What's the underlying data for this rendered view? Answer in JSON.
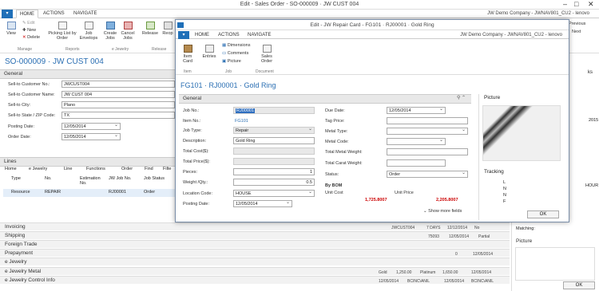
{
  "window": {
    "title": "Edit - Sales Order - SO-000009 · JW CUST 004",
    "minimize": "–",
    "maximize": "□",
    "close": "✕"
  },
  "tabs": [
    "HOME",
    "ACTIONS",
    "NAVIGATE"
  ],
  "company": "JW Demo Company - JWNAV801_CU2 - lenovo",
  "ribbon": {
    "view": "View",
    "edit": "Edit",
    "new": "New",
    "delete": "Delete",
    "picking_list": "Picking List by Order",
    "job_envelops": "Job Envelops",
    "create_jobs": "Create Jobs",
    "cancel_jobs": "Cancel Jobs",
    "release": "Release",
    "reopen": "Reop",
    "previous": "Previous",
    "next": "Next",
    "groups": {
      "manage": "Manage",
      "reports": "Reports",
      "ejewelry": "e Jewelry",
      "release": "Release"
    }
  },
  "page_title": "SO-000009 · JW CUST 004",
  "general": {
    "header": "General",
    "fields": [
      {
        "label": "Sell-to Customer No.:",
        "value": "JWCUST004"
      },
      {
        "label": "Sell-to Customer Name:",
        "value": "JW CUST 004"
      },
      {
        "label": "Sell-to City:",
        "value": "Plano"
      },
      {
        "label": "Sell-to State / ZIP Code:",
        "value": "TX"
      },
      {
        "label": "Posting Date:",
        "value": "12/05/2014"
      },
      {
        "label": "Order Date:",
        "value": "12/05/2014"
      }
    ]
  },
  "lines": {
    "header": "Lines",
    "toolbar": [
      "Home",
      "e Jewelry",
      "Line",
      "Functions",
      "Order",
      "Find",
      "Filte"
    ],
    "columns": [
      "Type",
      "No.",
      "Estimation No.",
      "JW Job No.",
      "Job Status"
    ],
    "row": [
      "Resource",
      "REPAIR",
      "",
      "RJ00001",
      "Order"
    ]
  },
  "fasttabs": [
    {
      "label": "Invoicing",
      "vals": [
        "JWCUST004",
        "7 DAYS",
        "12/12/2014",
        "No"
      ]
    },
    {
      "label": "Shipping",
      "vals": [
        "75093",
        "12/05/2014",
        "Partial"
      ]
    },
    {
      "label": "Foreign Trade",
      "vals": []
    },
    {
      "label": "Prepayment",
      "vals": [
        "0",
        "12/05/2014"
      ]
    },
    {
      "label": "e Jewelry",
      "vals": []
    },
    {
      "label": "e Jewelry Metal",
      "vals": [
        "Gold",
        "1,250.00",
        "Platinum",
        "1,650.00",
        "12/05/2014"
      ]
    },
    {
      "label": "e Jewelry Control Info",
      "vals": [
        "12/05/2014",
        "BCINC\\ANIL",
        "12/05/2014",
        "BCINC\\ANIL"
      ]
    }
  ],
  "right_panel": {
    "hours": "HOUR",
    "year": "2015",
    "matching": "Matching:",
    "picture": "Picture",
    "ok": "OK",
    "ks": "ks"
  },
  "dialog": {
    "title": "Edit - JW Repair Card - FG101 · RJ00001 · Gold Ring",
    "tabs": [
      "HOME",
      "ACTIONS",
      "NAVIGATE"
    ],
    "company": "JW Demo Company - JWNAV801_CU2 - lenovo",
    "ribbon": {
      "item_card": "Item Card",
      "entries": "Entries",
      "dimensions": "Dimensions",
      "comments": "Comments",
      "picture": "Picture",
      "sales_order": "Sales Order",
      "g_item": "Item",
      "g_job": "Job",
      "g_document": "Document"
    },
    "page_title": "FG101 · RJ00001 · Gold Ring",
    "general_header": "General",
    "left_fields": [
      {
        "label": "Job No.:",
        "value": "RJ00001"
      },
      {
        "label": "Item No.:",
        "value": "FG101"
      },
      {
        "label": "Job Type:",
        "value": "Repair"
      },
      {
        "label": "Description:",
        "value": "Gold Ring"
      },
      {
        "label": "Total Cost($):",
        "value": ""
      },
      {
        "label": "Total Price($):",
        "value": ""
      },
      {
        "label": "Pieces:",
        "value": "1"
      },
      {
        "label": "Weight /Qty.:",
        "value": "0.5"
      },
      {
        "label": "Location Code:",
        "value": "HOUSE"
      },
      {
        "label": "Posting Date:",
        "value": "12/05/2014"
      }
    ],
    "right_fields": [
      {
        "label": "Due Date:",
        "value": "12/05/2014"
      },
      {
        "label": "Tag Price:",
        "value": ""
      },
      {
        "label": "Metal Type:",
        "value": ""
      },
      {
        "label": "Metal Code:",
        "value": ""
      },
      {
        "label": "Total Metal Weight:",
        "value": ""
      },
      {
        "label": "Total Carat Weight:",
        "value": ""
      },
      {
        "label": "Status:",
        "value": "Order"
      }
    ],
    "bom": {
      "title": "By BOM",
      "unit_cost_label": "Unit Cost",
      "unit_price_label": "Unit Price",
      "unit_cost": "1,725.8007",
      "unit_price": "2,205.8007"
    },
    "show_more": "Show more fields",
    "picture": "Picture",
    "tracking": "Tracking",
    "tracking_rows": [
      "L",
      "N",
      "N",
      "F"
    ],
    "ok": "OK"
  }
}
